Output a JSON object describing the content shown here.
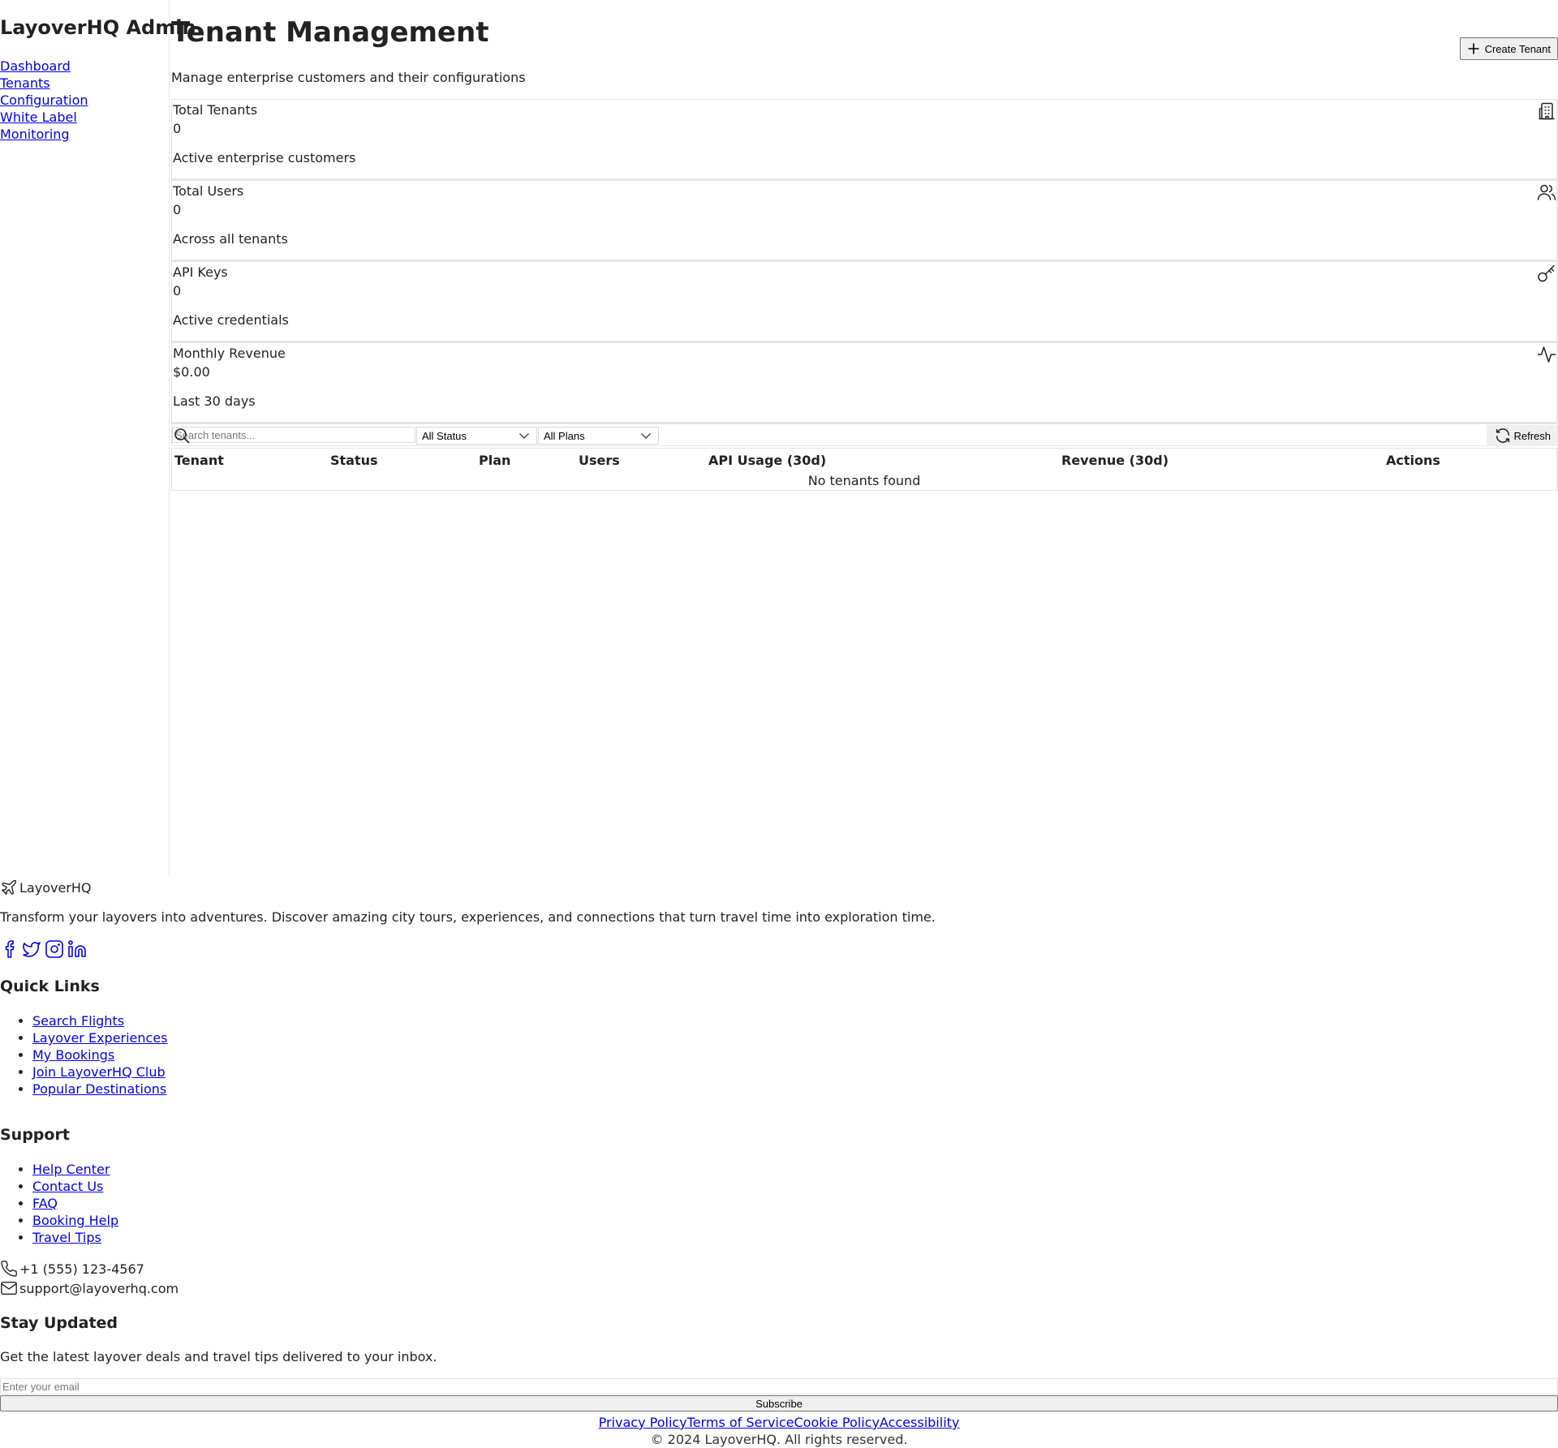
{
  "sidebar": {
    "brand": "LayoverHQ Admin",
    "nav": [
      "Dashboard",
      "Tenants",
      "Configuration",
      "White Label",
      "Monitoring"
    ]
  },
  "header": {
    "title": "Tenant Management",
    "subtitle": "Manage enterprise customers and their configurations",
    "create_label": "Create Tenant"
  },
  "stats": [
    {
      "label": "Total Tenants",
      "value": "0",
      "desc": "Active enterprise customers",
      "icon": "building-icon"
    },
    {
      "label": "Total Users",
      "value": "0",
      "desc": "Across all tenants",
      "icon": "users-icon"
    },
    {
      "label": "API Keys",
      "value": "0",
      "desc": "Active credentials",
      "icon": "key-icon"
    },
    {
      "label": "Monthly Revenue",
      "value": "$0.00",
      "desc": "Last 30 days",
      "icon": "activity-icon"
    }
  ],
  "filters": {
    "search_placeholder": "Search tenants...",
    "status_selected": "All Status",
    "plan_selected": "All Plans",
    "refresh_label": "Refresh"
  },
  "table": {
    "columns": [
      "Tenant",
      "Status",
      "Plan",
      "Users",
      "API Usage (30d)",
      "Revenue (30d)",
      "Actions"
    ],
    "empty_message": "No tenants found"
  },
  "footer": {
    "brand": "LayoverHQ",
    "tagline": "Transform your layovers into adventures. Discover amazing city tours, experiences, and connections that turn travel time into exploration time.",
    "socials": [
      "facebook-icon",
      "twitter-icon",
      "instagram-icon",
      "linkedin-icon"
    ],
    "quick_links": {
      "heading": "Quick Links",
      "items": [
        "Search Flights",
        "Layover Experiences",
        "My Bookings",
        "Join LayoverHQ Club",
        "Popular Destinations"
      ]
    },
    "support": {
      "heading": "Support",
      "items": [
        "Help Center",
        "Contact Us",
        "FAQ",
        "Booking Help",
        "Travel Tips"
      ]
    },
    "phone": "+1 (555) 123-4567",
    "email": "support@layoverhq.com",
    "newsletter": {
      "heading": "Stay Updated",
      "desc": "Get the latest layover deals and travel tips delivered to your inbox.",
      "placeholder": "Enter your email",
      "button": "Subscribe"
    },
    "legal_links": [
      "Privacy Policy",
      "Terms of Service",
      "Cookie Policy",
      "Accessibility"
    ],
    "copyright": "© 2024 LayoverHQ. All rights reserved."
  },
  "colors": {
    "link": "#0000ee",
    "border": "#e4e4e4",
    "button_bg": "#efefef"
  }
}
